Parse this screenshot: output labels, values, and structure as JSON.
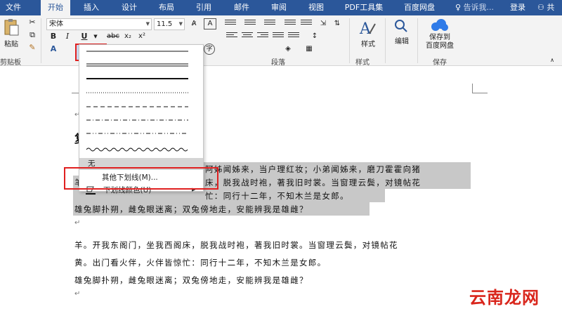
{
  "tabs": [
    "文件",
    "开始",
    "插入",
    "设计",
    "布局",
    "引用",
    "邮件",
    "审阅",
    "视图",
    "PDF工具集",
    "百度网盘"
  ],
  "tell_me": "告诉我...",
  "login": "登录",
  "share": "共",
  "ribbon": {
    "paste": "粘贴",
    "clipboard": "剪贴板",
    "font_name": "宋体",
    "font_size": "11.5",
    "bold": "B",
    "italic": "I",
    "underline": "U",
    "strike": "abc",
    "subscript": "x₂",
    "superscript": "x²",
    "paragraph": "段落",
    "styles": "样式",
    "styles_group": "样式",
    "edit": "编辑",
    "save_to_baidu": "保存到\n百度网盘",
    "save_group": "保存",
    "font_aa": "A",
    "char_box": "A",
    "enclosed": "字"
  },
  "dropdown": {
    "none": "无",
    "more": "其他下划线(M)...",
    "color": "下划线颜色(U)",
    "grip": "....."
  },
  "doc": {
    "heading_char": "复",
    "line1_tail": "阿姊闻姊来，当户理红妆；小弟闻姊来，磨刀霍霍向猪",
    "line2_prefix": "羊",
    "line2_tail": "床，脱我战时袍，著我旧时裳。当窗理云鬓，对镜帖花",
    "line3_tail": "忙：同行十二年，不知木兰是女郎。",
    "line4": "雄兔脚扑朔，雌兔眼迷离；双兔傍地走，安能辨我是雄雌？",
    "para2_l1": "羊。开我东阁门，坐我西阁床，脱我战时袍，著我旧时裳。当窗理云鬓，对镜帖花",
    "para2_l2": "黄。出门看火伴，火伴皆惊忙：同行十二年，不知木兰是女郎。",
    "para2_l3": "雄兔脚扑朔，雌兔眼迷离；双兔傍地走，安能辨我是雄雌？",
    "para_mark": "↵"
  },
  "watermark": "云南龙网",
  "colors": {
    "ribbon_blue": "#2b579a",
    "highlight_red": "#e02020",
    "selection_gray": "#c8c8c8"
  }
}
